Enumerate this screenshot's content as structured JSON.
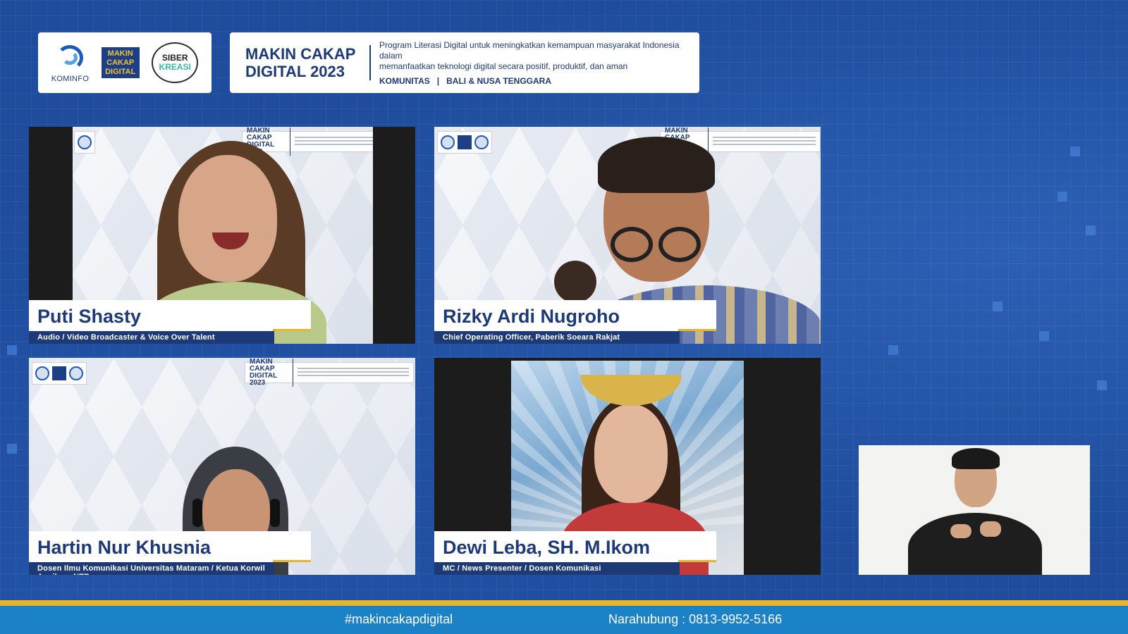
{
  "header": {
    "logos": {
      "kominfo": "KOMINFO",
      "makin_cakap_digital": [
        "MAKIN",
        "CAKAP",
        "DIGITAL"
      ],
      "siberkreasi": [
        "SIBER",
        "KREASI"
      ]
    },
    "title_line1": "MAKIN CAKAP",
    "title_line2": "DIGITAL 2023",
    "description_line1": "Program Literasi Digital untuk meningkatkan kemampuan masyarakat Indonesia dalam",
    "description_line2": "memanfaatkan teknologi digital secara positif, produktif, dan aman",
    "tag_community": "KOMUNITAS",
    "tag_separator": "|",
    "tag_region": "BALI & NUSA TENGGARA"
  },
  "participants": [
    {
      "name": "Puti Shasty",
      "role": "Audio / Video Broadcaster & Voice Over Talent"
    },
    {
      "name": "Rizky Ardi Nugroho",
      "role": "Chief Operating Officer, Paberik Soeara Rakjat"
    },
    {
      "name": "Hartin Nur Khusnia",
      "role": "Dosen Ilmu Komunikasi Universitas Mataram / Ketua Korwil Aspikom NTB"
    },
    {
      "name": "Dewi Leba, SH. M.Ikom",
      "role": "MC / News Presenter / Dosen Komunikasi"
    }
  ],
  "footer": {
    "hashtag": "#makincakapdigital",
    "contact": "Narahubung : 0813-9952-5166"
  },
  "colors": {
    "background": "#1f4c9c",
    "navy": "#1d3a77",
    "accent_gold": "#e8b42a",
    "footer_blue": "#1b82c8"
  }
}
